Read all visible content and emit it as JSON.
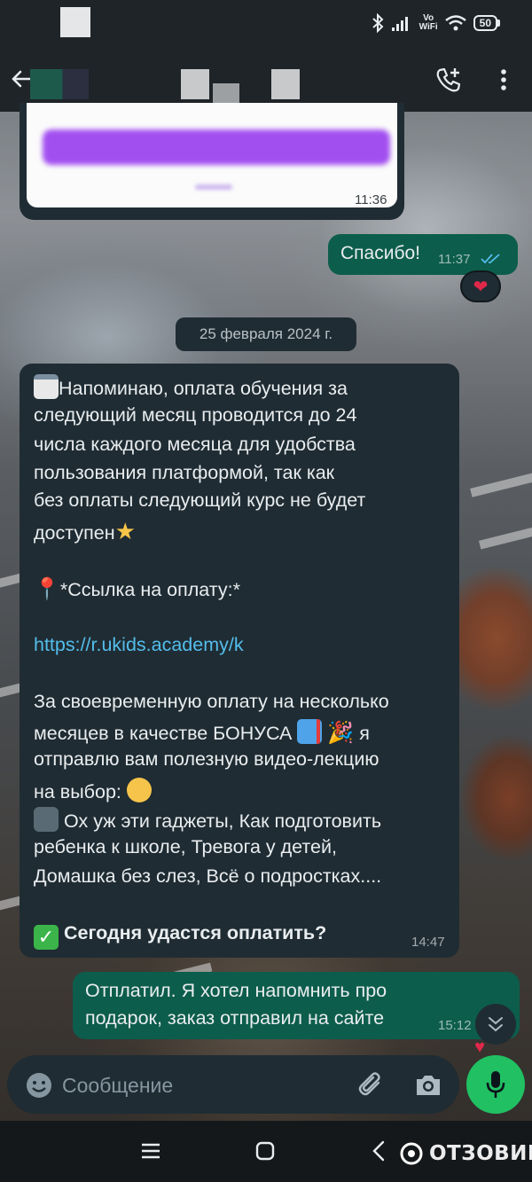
{
  "status_bar": {
    "battery": "50",
    "volte_top": "Vo",
    "volte_bottom": "WiFi"
  },
  "header": {
    "back_icon": "arrow-left-icon",
    "call_icon": "phone-plus-icon",
    "menu_icon": "more-vertical-icon"
  },
  "messages": {
    "card_time": "11:36",
    "thanks_text": "Спасибо!",
    "thanks_time": "11:37",
    "thanks_reaction": "❤",
    "date_chip": "25 февраля 2024 г.",
    "reminder": {
      "line1": "Напоминаю, оплата обучения за",
      "line2": "следующий месяц проводится до 24",
      "line3": "числа каждого месяца для удобства",
      "line4": "пользования платформой, так как",
      "line5": "без оплаты следующий курс не будет",
      "line6": "доступен",
      "link_label": "*Ссылка на оплату:*",
      "link_url": "https://r.ukids.academy/k",
      "bonus1": "За своевременную оплату на несколько",
      "bonus2": "месяцев в качестве БОНУСА",
      "bonus2_end": "я",
      "bonus3": "отправлю вам полезную видео-лекцию",
      "bonus4": "на выбор:",
      "topics1": "Ох уж эти гаджеты, Как подготовить",
      "topics2": "ребенка к школе, Тревога у детей,",
      "topics3": "Домашка без слез, Всё о подростках....",
      "question": "Сегодня удастся оплатить?",
      "time": "14:47"
    },
    "reply": {
      "line1": "Отплатил. Я хотел напомнить про",
      "line2": "подарок, заказ отправил на сайте",
      "time": "15:12"
    }
  },
  "input": {
    "placeholder": "Сообщение"
  },
  "watermark": "ОТЗОВИК",
  "colors": {
    "incoming_bubble": "#1f2c33",
    "outgoing_bubble": "#0d5d4c",
    "link": "#53bdeb",
    "mic_button": "#21c063",
    "read_ticks": "#53bdeb"
  }
}
